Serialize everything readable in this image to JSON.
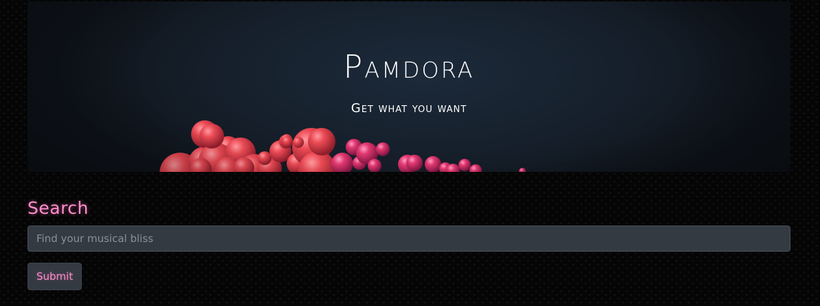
{
  "hero": {
    "title": "Pamdora",
    "subtitle": "Get what you want"
  },
  "search": {
    "heading": "Search",
    "placeholder": "Find your musical bliss",
    "value": "",
    "submit_label": "Submit"
  },
  "colors": {
    "accent": "#ff8ecb",
    "input_bg": "#343a42",
    "hero_bg": "#16202c",
    "sphere_red": "#e8424f",
    "sphere_pink": "#e63c7c"
  }
}
